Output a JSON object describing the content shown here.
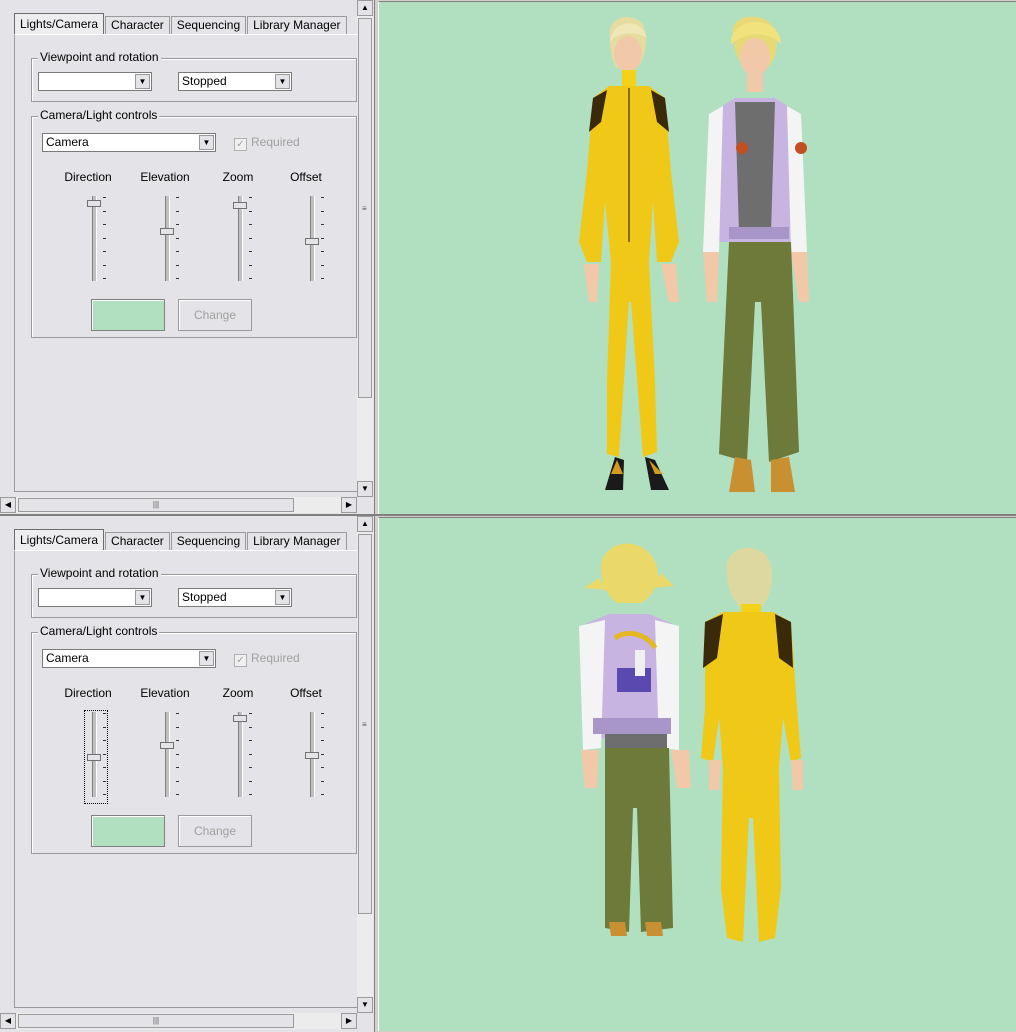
{
  "tabs": [
    "Lights/Camera",
    "Character",
    "Sequencing",
    "Library Manager"
  ],
  "viewpoint": {
    "group_title": "Viewpoint and rotation",
    "viewpoint_value": "",
    "rotation_value": "Stopped"
  },
  "camera_light": {
    "group_title": "Camera/Light controls",
    "target_value": "Camera",
    "required_label": "Required",
    "required_checked": true,
    "sliders": [
      "Direction",
      "Elevation",
      "Zoom",
      "Offset"
    ],
    "change_label": "Change",
    "color": "#b1e0c0"
  },
  "panes": [
    {
      "view_side": "front",
      "slider_levels": [
        0.05,
        0.4,
        0.08,
        0.52
      ],
      "focused_slider": null
    },
    {
      "view_side": "back",
      "slider_levels": [
        0.52,
        0.38,
        0.04,
        0.5
      ],
      "focused_slider": "Direction"
    }
  ],
  "icons": {
    "dropdown": "chevron-down-icon",
    "scroll_up": "arrow-up-icon",
    "scroll_down": "arrow-down-icon",
    "scroll_left": "arrow-left-icon",
    "scroll_right": "arrow-right-icon"
  },
  "viewport_background": "#b1e0c0"
}
